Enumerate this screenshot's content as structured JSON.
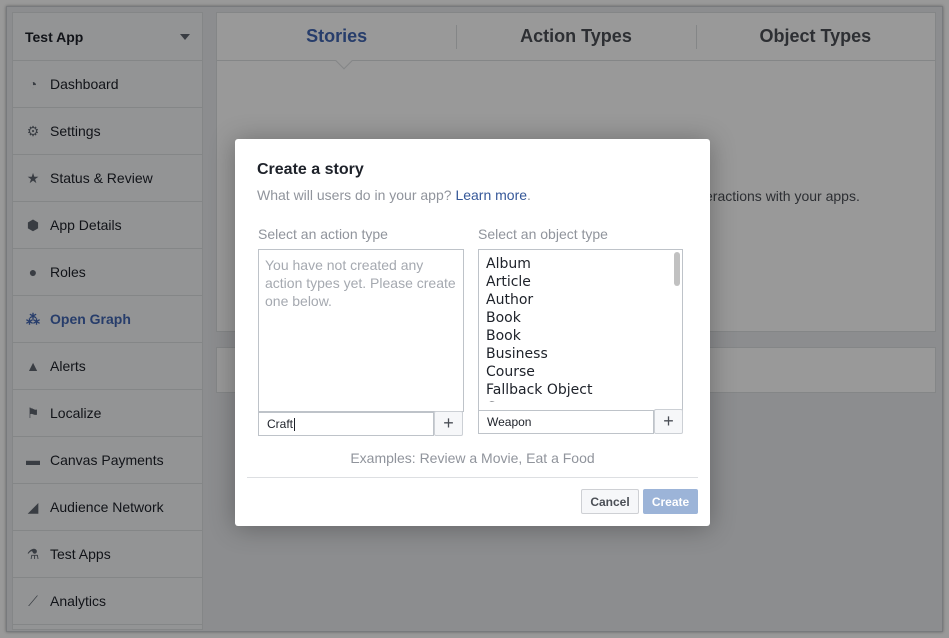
{
  "sidebar": {
    "app_name": "Test App",
    "items": [
      {
        "label": "Dashboard",
        "icon": "dashboard-icon",
        "glyph": "◔"
      },
      {
        "label": "Settings",
        "icon": "gear-icon",
        "glyph": "⚙"
      },
      {
        "label": "Status & Review",
        "icon": "star-icon",
        "glyph": "★"
      },
      {
        "label": "App Details",
        "icon": "cube-icon",
        "glyph": "⬢"
      },
      {
        "label": "Roles",
        "icon": "person-icon",
        "glyph": "●"
      },
      {
        "label": "Open Graph",
        "icon": "open-graph-icon",
        "glyph": "⁂",
        "active": true
      },
      {
        "label": "Alerts",
        "icon": "warning-icon",
        "glyph": "▲"
      },
      {
        "label": "Localize",
        "icon": "flag-icon",
        "glyph": "⚑"
      },
      {
        "label": "Canvas Payments",
        "icon": "credit-card-icon",
        "glyph": "▬"
      },
      {
        "label": "Audience Network",
        "icon": "megaphone-icon",
        "glyph": "◢"
      },
      {
        "label": "Test Apps",
        "icon": "flask-icon",
        "glyph": "⚗"
      },
      {
        "label": "Analytics",
        "icon": "chart-icon",
        "glyph": "⟋"
      }
    ]
  },
  "tabs": [
    {
      "label": "Stories",
      "active": true
    },
    {
      "label": "Action Types"
    },
    {
      "label": "Object Types"
    }
  ],
  "main": {
    "background_text": "eractions with your apps."
  },
  "dialog": {
    "title": "Create a story",
    "subtitle": "What will users do in your app?",
    "learn_more": "Learn more",
    "subtitle_end": ".",
    "action_label": "Select an action type",
    "action_empty": "You have not created any action types yet. Please create one below.",
    "action_input_value": "Craft",
    "object_label": "Select an object type",
    "object_types": [
      "Album",
      "Article",
      "Author",
      "Book",
      "Book",
      "Business",
      "Course",
      "Fallback Object",
      "Game"
    ],
    "object_input_value": "Weapon",
    "plus": "+",
    "examples": "Examples: Review a Movie, Eat a Food",
    "cancel": "Cancel",
    "create": "Create"
  },
  "colors": {
    "accent": "#4267b2",
    "link": "#365899",
    "create_disabled": "#9cb4d8"
  }
}
